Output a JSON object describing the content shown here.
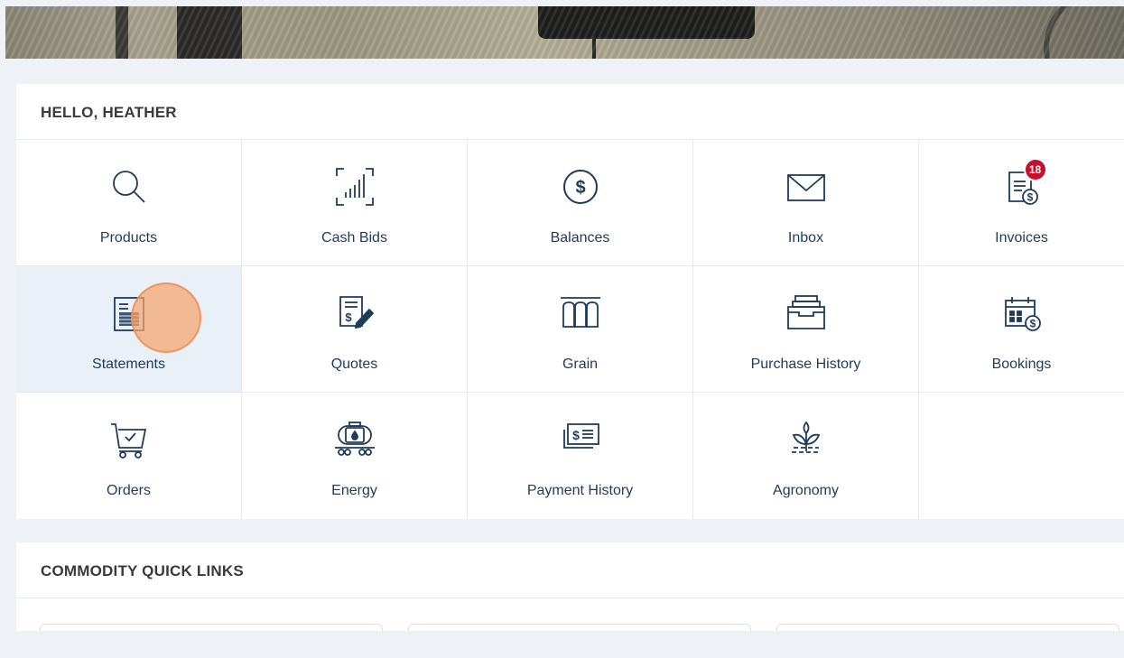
{
  "greeting": {
    "title": "HELLO, HEATHER"
  },
  "tiles": [
    {
      "label": "Products",
      "icon": "search-icon"
    },
    {
      "label": "Cash Bids",
      "icon": "cash-bids-icon"
    },
    {
      "label": "Balances",
      "icon": "dollar-circle-icon"
    },
    {
      "label": "Inbox",
      "icon": "envelope-icon"
    },
    {
      "label": "Invoices",
      "icon": "invoice-icon",
      "badge": "18"
    },
    {
      "label": "Statements",
      "icon": "statement-icon",
      "selected": true
    },
    {
      "label": "Quotes",
      "icon": "quote-icon"
    },
    {
      "label": "Grain",
      "icon": "grain-bin-icon"
    },
    {
      "label": "Purchase History",
      "icon": "file-drawer-icon"
    },
    {
      "label": "Bookings",
      "icon": "calendar-dollar-icon"
    },
    {
      "label": "Orders",
      "icon": "cart-check-icon"
    },
    {
      "label": "Energy",
      "icon": "tanker-icon"
    },
    {
      "label": "Payment History",
      "icon": "money-stack-icon"
    },
    {
      "label": "Agronomy",
      "icon": "sprout-icon"
    }
  ],
  "commodity": {
    "title": "COMMODITY QUICK LINKS"
  },
  "colors": {
    "icon": "#1f3b5a",
    "label": "#1f3b5a",
    "badge": "#c8102e",
    "selected_bg": "#e9f0f8",
    "page_bg": "#eef1f5"
  }
}
